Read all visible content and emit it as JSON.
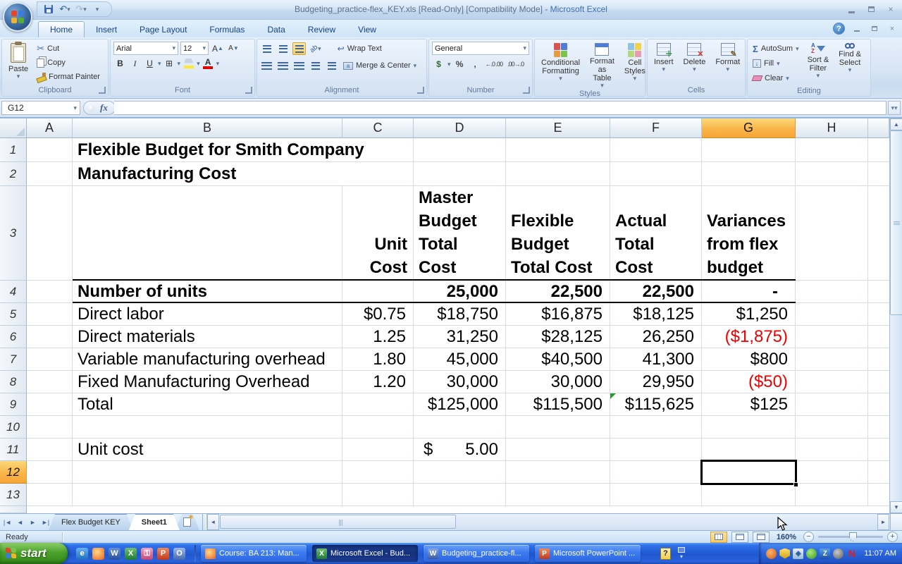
{
  "titlebar": {
    "file_title": "Budgeting_practice-flex_KEY.xls  [Read-Only]  [Compatibility Mode]",
    "separator": " - ",
    "app_name": "Microsoft Excel"
  },
  "ribbon": {
    "tabs": [
      "Home",
      "Insert",
      "Page Layout",
      "Formulas",
      "Data",
      "Review",
      "View"
    ],
    "active_tab": "Home",
    "groups": {
      "clipboard": {
        "label": "Clipboard",
        "paste": "Paste",
        "cut": "Cut",
        "copy": "Copy",
        "format_painter": "Format Painter"
      },
      "font": {
        "label": "Font",
        "font_name": "Arial",
        "font_size": "12"
      },
      "alignment": {
        "label": "Alignment",
        "wrap_text": "Wrap Text",
        "merge_center": "Merge & Center"
      },
      "number": {
        "label": "Number",
        "format": "General"
      },
      "styles": {
        "label": "Styles",
        "conditional_formatting": "Conditional\nFormatting",
        "format_as_table": "Format\nas Table",
        "cell_styles": "Cell\nStyles"
      },
      "cells": {
        "label": "Cells",
        "insert": "Insert",
        "delete": "Delete",
        "format": "Format"
      },
      "editing": {
        "label": "Editing",
        "autosum": "AutoSum",
        "fill": "Fill",
        "clear": "Clear",
        "sort_filter": "Sort &\nFilter",
        "find_select": "Find &\nSelect"
      }
    }
  },
  "formula_bar": {
    "name_box": "G12",
    "fx_label": "fx",
    "formula_value": ""
  },
  "sheet": {
    "column_letters": [
      "A",
      "B",
      "C",
      "D",
      "E",
      "F",
      "G",
      "H"
    ],
    "row_numbers": [
      "1",
      "2",
      "3",
      "4",
      "5",
      "6",
      "7",
      "8",
      "9",
      "10",
      "11",
      "12",
      "13"
    ],
    "selected_cell": "G12",
    "title_line1": "Flexible Budget for Smith Company",
    "title_line2": "Manufacturing Cost",
    "header_row": {
      "unit_cost": "Unit\nCost",
      "master_budget": "Master\nBudget\nTotal\nCost",
      "flexible_budget": "Flexible\nBudget\nTotal Cost",
      "actual": "Actual\nTotal\nCost",
      "variances": "Variances\nfrom flex\nbudget"
    },
    "data_rows": [
      {
        "label": "Number of units",
        "unit_cost": "",
        "master": "25,000",
        "flex": "22,500",
        "actual": "22,500",
        "variance": "-"
      },
      {
        "label": "Direct labor",
        "unit_cost": "$0.75",
        "master": "$18,750",
        "flex": "$16,875",
        "actual": "$18,125",
        "variance": "$1,250"
      },
      {
        "label": "Direct materials",
        "unit_cost": "1.25",
        "master": "31,250",
        "flex": "$28,125",
        "actual": "26,250",
        "variance": "($1,875)"
      },
      {
        "label": "Variable manufacturing overhead",
        "unit_cost": "1.80",
        "master": "45,000",
        "flex": "$40,500",
        "actual": "41,300",
        "variance": "$800"
      },
      {
        "label": "Fixed Manufacturing Overhead",
        "unit_cost": "1.20",
        "master": "30,000",
        "flex": "30,000",
        "actual": "29,950",
        "variance": "($50)"
      },
      {
        "label": "Total",
        "unit_cost": "",
        "master": "$125,000",
        "flex": "$115,500",
        "actual": "$115,625",
        "variance": "$125"
      }
    ],
    "unit_cost_row": {
      "label": "Unit cost",
      "currency": "$",
      "value": "5.00"
    }
  },
  "sheet_tabs": {
    "tabs": [
      "Flex Budget KEY",
      "Sheet1"
    ],
    "active_tab": "Sheet1"
  },
  "status_bar": {
    "mode": "Ready",
    "zoom_level": "160%"
  },
  "taskbar": {
    "start_label": "start",
    "window_buttons": [
      {
        "label": "Course: BA 213: Man..."
      },
      {
        "label": "Microsoft Excel - Bud..."
      },
      {
        "label": "Budgeting_practice-fl..."
      },
      {
        "label": "Microsoft PowerPoint ..."
      }
    ],
    "clock": "11:07 AM"
  }
}
